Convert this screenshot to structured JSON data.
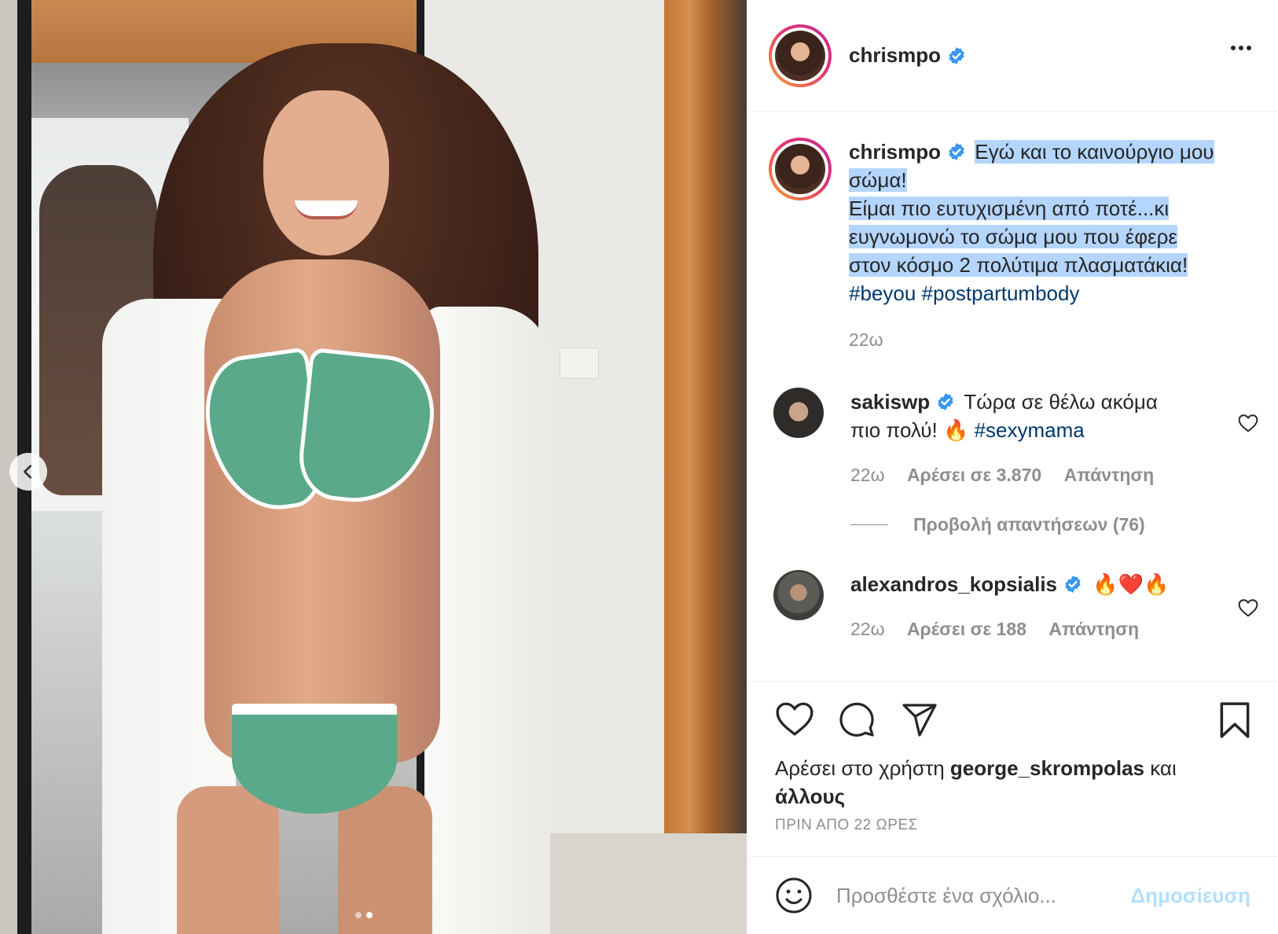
{
  "post": {
    "author": "chrismpo",
    "caption_lines": [
      "Εγώ και το καινούργιο μου",
      "σώμα!",
      "Είμαι πιο ευτυχισμένη από ποτέ...κι",
      "ευγνωμονώ το σώμα μου που έφερε",
      "στον κόσμο 2 πολύτιμα πλασματάκια!"
    ],
    "hashtags": [
      "#beyou",
      "#postpartumbody"
    ],
    "caption_time": "22ω",
    "likes_prefix": "Αρέσει στο χρήστη",
    "likes_user": "george_skrompolas",
    "likes_and": "και",
    "likes_others": "άλλους",
    "timestamp": "ΠΡΙΝ ΑΠΟ 22 ΩΡΕΣ"
  },
  "comments": [
    {
      "username": "sakiswp",
      "text_1": "Τώρα σε θέλω ακόμα",
      "text_2": "πιο πολύ! 🔥",
      "hashtag": "#sexymama",
      "time": "22ω",
      "likes": "Αρέσει σε 3.870",
      "reply": "Απάντηση",
      "view_replies": "Προβολή απαντήσεων (76)"
    },
    {
      "username": "alexandros_kopsialis",
      "text": "🔥❤️🔥",
      "time": "22ω",
      "likes": "Αρέσει σε 188",
      "reply": "Απάντηση"
    }
  ],
  "composer": {
    "placeholder": "Προσθέστε ένα σχόλιο...",
    "post_label": "Δημοσίευση"
  },
  "carousel": {
    "index": 2,
    "total": 2
  },
  "colors": {
    "verified": "#3897f0",
    "link": "#00376b",
    "highlight": "#b4d5fe",
    "post_disabled": "#b2dffc"
  }
}
